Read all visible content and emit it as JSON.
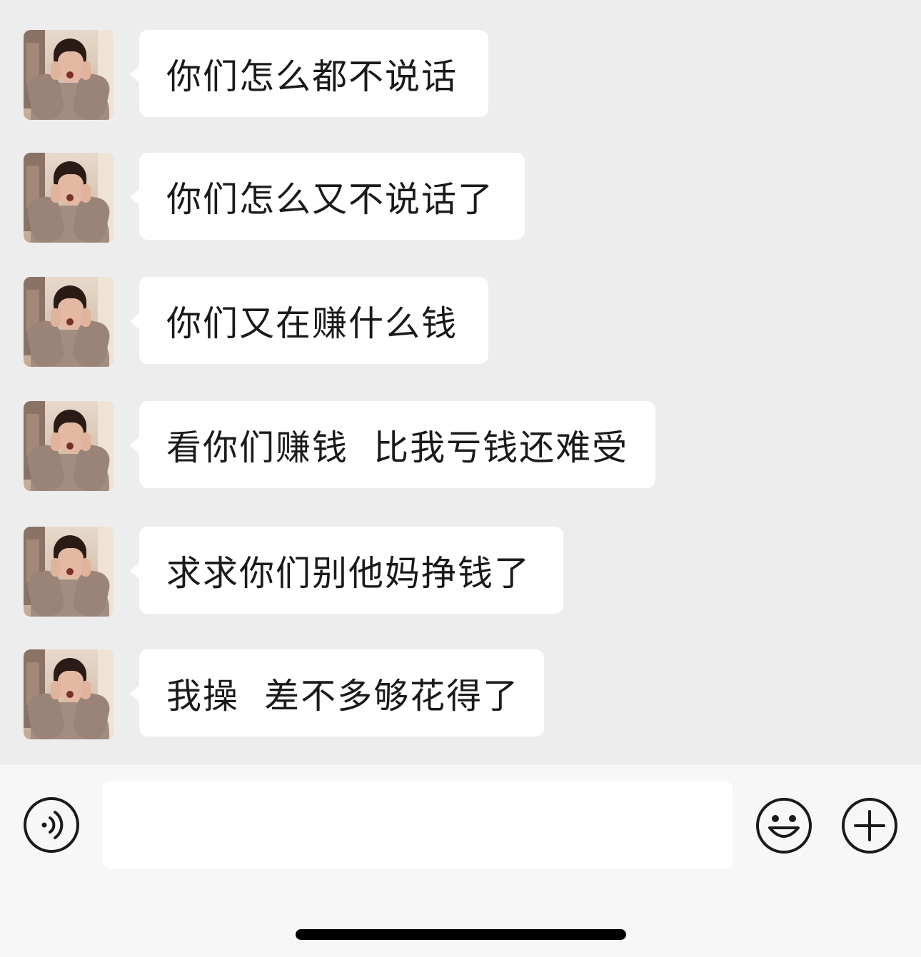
{
  "messages": [
    {
      "text": "你们怎么都不说话",
      "avatar": "avatar-photo"
    },
    {
      "text": "你们怎么又不说话了",
      "avatar": "avatar-photo"
    },
    {
      "text": "你们又在赚什么钱",
      "avatar": "avatar-photo"
    },
    {
      "text": "看你们赚钱  比我亏钱还难受",
      "avatar": "avatar-photo"
    },
    {
      "text": "求求你们别他妈挣钱了",
      "avatar": "avatar-photo"
    },
    {
      "text": "我操  差不多够花得了",
      "avatar": "avatar-photo"
    }
  ],
  "input_bar": {
    "value": "",
    "placeholder": "",
    "icons": [
      "voice-icon",
      "emoji-icon",
      "plus-icon"
    ]
  },
  "colors": {
    "chat_background": "#ededed",
    "bubble": "#ffffff",
    "text": "#1a1a1a",
    "input_bar_background": "#f7f7f7"
  }
}
